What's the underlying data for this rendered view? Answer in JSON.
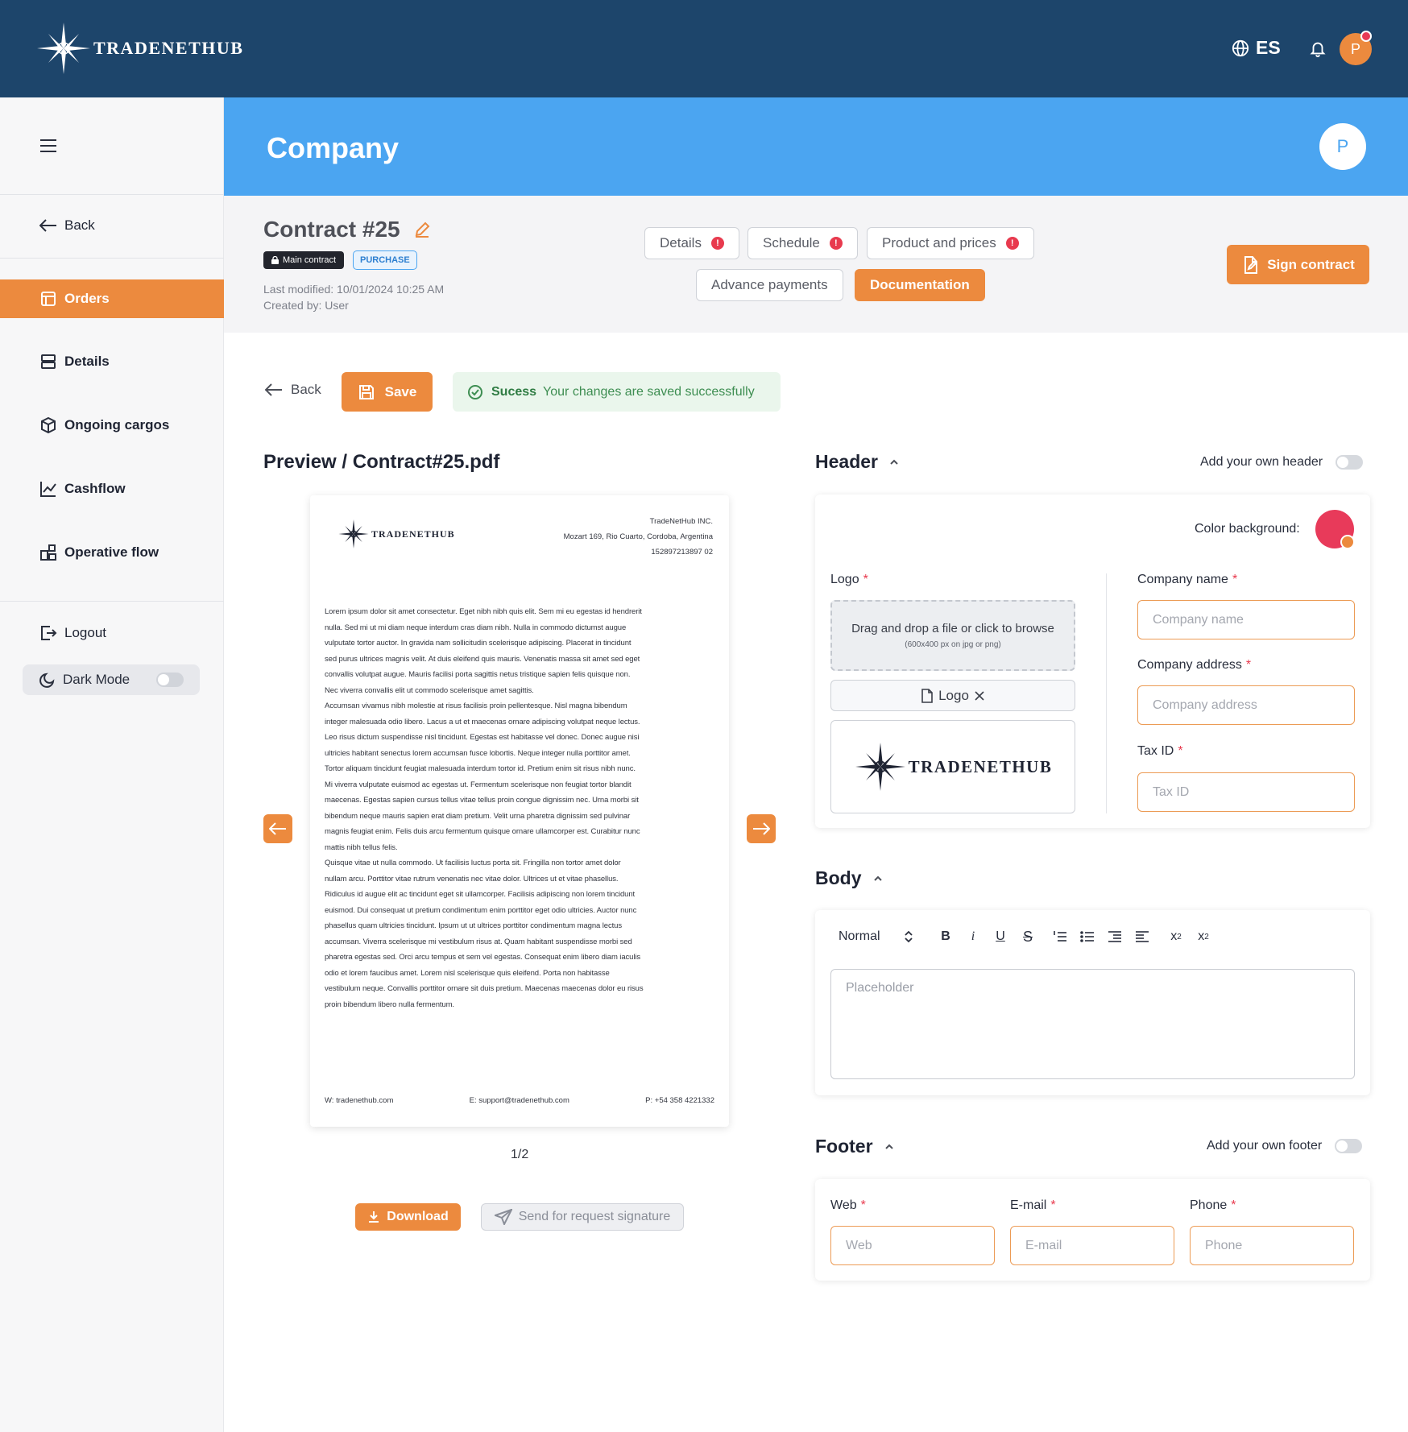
{
  "topbar": {
    "brand": "TRADENETHUB",
    "language": "ES",
    "user_initial": "P"
  },
  "sidebar": {
    "back": "Back",
    "items": [
      {
        "label": "Orders",
        "icon": "orders-icon",
        "active": true
      },
      {
        "label": "Details",
        "icon": "details-icon"
      },
      {
        "label": "Ongoing cargos",
        "icon": "box-icon"
      },
      {
        "label": "Cashflow",
        "icon": "chart-line-icon"
      },
      {
        "label": "Operative flow",
        "icon": "flow-icon"
      }
    ],
    "logout": "Logout",
    "dark_mode": "Dark Mode",
    "dark_mode_on": false
  },
  "banner": {
    "title": "Company",
    "avatar_initial": "P"
  },
  "contract": {
    "title": "Contract #25",
    "badge_main": "Main contract",
    "badge_type": "PURCHASE",
    "last_modified": "Last modified: 10/01/2024 10:25 AM",
    "created_by": "Created by: User",
    "tabs": [
      {
        "label": "Details",
        "error": true
      },
      {
        "label": "Schedule",
        "error": true
      },
      {
        "label": "Product and prices",
        "error": true
      },
      {
        "label": "Advance payments",
        "error": false
      },
      {
        "label": "Documentation",
        "active": true
      }
    ],
    "sign_button": "Sign contract"
  },
  "actions": {
    "back": "Back",
    "save": "Save",
    "success_title": "Sucess",
    "success_message": "Your changes are saved successfully"
  },
  "preview": {
    "title": "Preview / Contract#25.pdf",
    "doc": {
      "brand": "TRADENETHUB",
      "address_lines": [
        "TradeNetHub INC.",
        "Mozart 169, Rio Cuarto, Cordoba, Argentina",
        "152897213897 02"
      ],
      "body_lines": [
        "Lorem ipsum dolor sit amet consectetur. Eget nibh nibh quis elit. Sem mi eu egestas id hendrerit",
        "nulla. Sed mi ut mi diam neque interdum cras diam nibh. Nulla in commodo dictumst augue",
        "vulputate tortor auctor. In gravida nam sollicitudin scelerisque adipiscing. Placerat in tincidunt",
        "sed purus ultrices magnis velit. At duis eleifend quis mauris. Venenatis massa sit amet sed eget",
        "convallis volutpat augue. Mauris facilisi porta sagittis netus tristique sapien felis quisque non.",
        "Nec viverra convallis elit ut commodo scelerisque amet sagittis.",
        "Accumsan vivamus nibh molestie at risus facilisis proin pellentesque. Nisl magna bibendum",
        "integer malesuada odio libero. Lacus a ut et maecenas ornare adipiscing volutpat neque lectus.",
        "Leo risus dictum suspendisse nisl tincidunt. Egestas est habitasse vel donec. Donec augue nisi",
        "ultricies habitant senectus lorem accumsan fusce lobortis. Neque integer nulla porttitor amet.",
        "Tortor aliquam tincidunt feugiat malesuada interdum tortor id. Pretium enim sit risus nibh nunc.",
        "Mi viverra vulputate euismod ac egestas ut. Fermentum scelerisque non feugiat tortor blandit",
        "maecenas. Egestas sapien cursus tellus vitae tellus proin congue dignissim nec. Urna morbi sit",
        "bibendum neque mauris sapien erat diam pretium. Velit urna pharetra dignissim sed pulvinar",
        "magnis feugiat enim. Felis duis arcu fermentum quisque ornare ullamcorper est. Curabitur nunc",
        "mattis nibh tellus felis.",
        "Quisque vitae ut nulla commodo. Ut facilisis luctus porta sit. Fringilla non tortor amet dolor",
        "nullam arcu. Porttitor vitae rutrum venenatis nec vitae dolor. Ultrices ut et vitae phasellus.",
        "Ridiculus id augue elit ac tincidunt eget sit ullamcorper. Facilisis adipiscing non lorem tincidunt",
        "euismod. Dui consequat ut pretium condimentum enim porttitor eget odio ultricies. Auctor nunc",
        "phasellus quam ultricies tincidunt. Ipsum ut ut ultrices porttitor condimentum magna lectus",
        "accumsan. Viverra scelerisque mi vestibulum risus at. Quam habitant suspendisse morbi sed",
        "pharetra egestas sed. Orci arcu tempus et sem vel egestas. Consequat enim libero diam iaculis",
        "odio et lorem faucibus amet. Lorem nisl scelerisque quis eleifend. Porta non habitasse",
        "vestibulum neque. Convallis porttitor ornare sit duis pretium. Maecenas maecenas dolor eu risus",
        "proin bibendum libero nulla fermentum."
      ],
      "footer_web": "W: tradenethub.com",
      "footer_email": "E: support@tradenethub.com",
      "footer_phone": "P: +54 358 4221332"
    },
    "pager": "1/2",
    "download": "Download",
    "send_signature": "Send for request signature"
  },
  "header_section": {
    "title": "Header",
    "own_toggle_label": "Add your own header",
    "color_label": "Color background:",
    "color_value": "#e83a5a",
    "logo_label": "Logo",
    "dropzone_text": "Drag and drop a file or click to browse",
    "dropzone_hint": "(600x400 px on jpg or png)",
    "file_chip": "Logo",
    "logo_preview_brand": "TRADENETHUB",
    "company_name_label": "Company name",
    "company_name_placeholder": "Company name",
    "company_address_label": "Company address",
    "company_address_placeholder": "Company address",
    "tax_id_label": "Tax ID",
    "tax_id_placeholder": "Tax ID"
  },
  "body_section": {
    "title": "Body",
    "style_select": "Normal",
    "editor_placeholder": "Placeholder"
  },
  "footer_section": {
    "title": "Footer",
    "own_toggle_label": "Add your own footer",
    "web_label": "Web",
    "web_placeholder": "Web",
    "email_label": "E-mail",
    "email_placeholder": "E-mail",
    "phone_label": "Phone",
    "phone_placeholder": "Phone"
  },
  "colors": {
    "topbar": "#1d456b",
    "banner": "#4ba5f1",
    "accent": "#ec8a3e",
    "error": "#e83a4e",
    "success": "#3e8e52"
  }
}
